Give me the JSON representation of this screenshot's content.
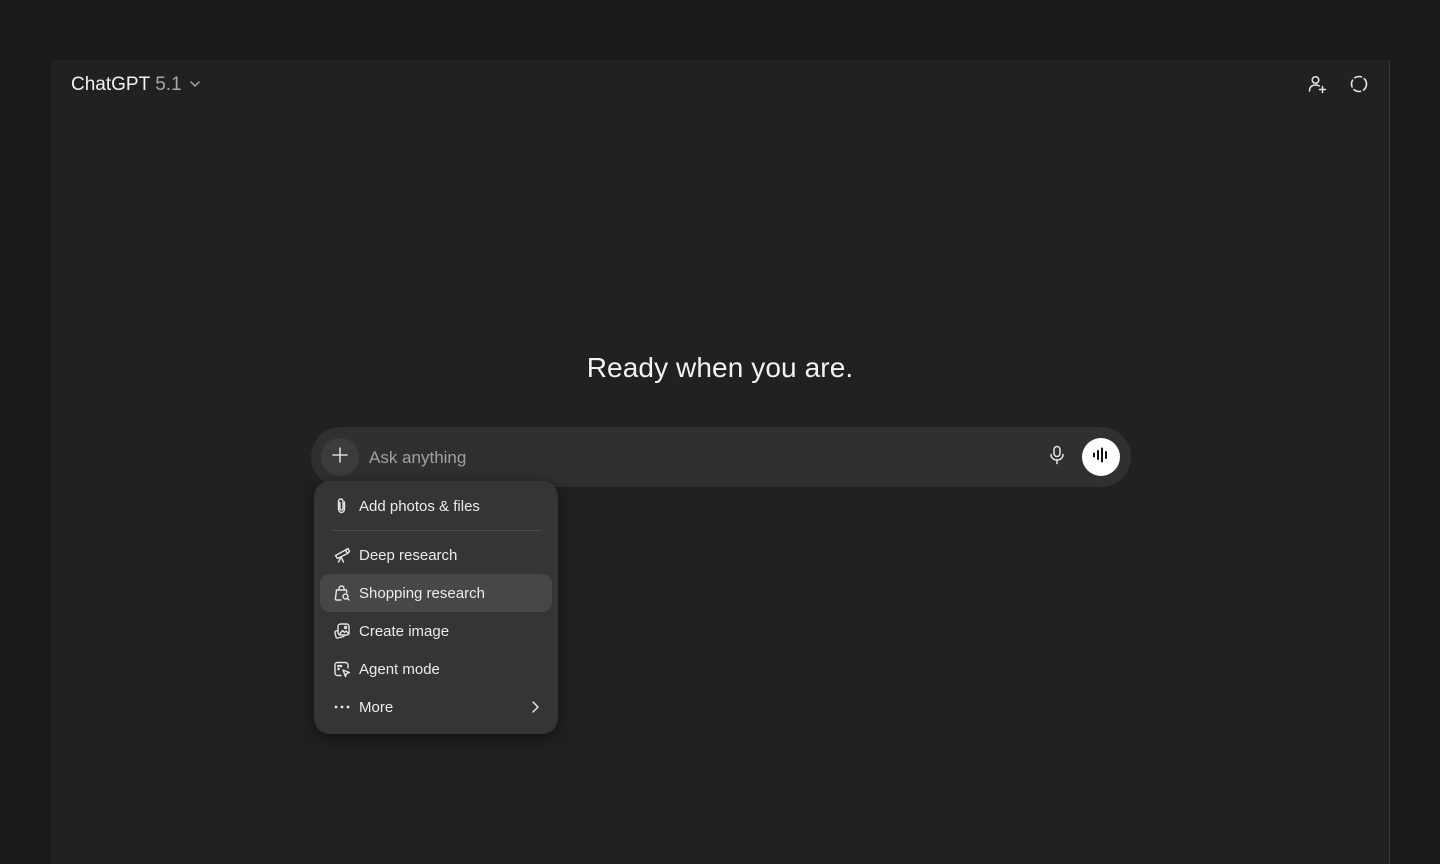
{
  "header": {
    "model_name": "ChatGPT",
    "model_version": "5.1",
    "model_switcher_icon": "chevron-down-icon",
    "actions": [
      {
        "name": "add-people-button",
        "icon": "person-add-icon"
      },
      {
        "name": "temporary-chat-button",
        "icon": "dashed-chat-icon"
      }
    ]
  },
  "main": {
    "hero_text": "Ready when you are."
  },
  "composer": {
    "placeholder": "Ask anything",
    "value": "",
    "plus_icon": "plus-icon",
    "mic_icon": "microphone-icon",
    "voice_icon": "voice-waveform-icon"
  },
  "menu": {
    "items": [
      {
        "label": "Add photos & files",
        "icon": "paperclip-icon"
      },
      {
        "label": "Deep research",
        "icon": "telescope-icon"
      },
      {
        "label": "Shopping research",
        "icon": "shopping-bag-search-icon",
        "active": true
      },
      {
        "label": "Create image",
        "icon": "image-create-icon"
      },
      {
        "label": "Agent mode",
        "icon": "agent-cursor-icon"
      },
      {
        "label": "More",
        "icon": "ellipsis-icon",
        "submenu_icon": "chevron-right-icon"
      }
    ]
  },
  "colors": {
    "page_background": "#1b1b1d",
    "window_background": "#212121",
    "composer_background": "#303030",
    "menu_background": "#353535",
    "menu_active": "#474747",
    "text_primary": "#ececec",
    "text_muted": "#a0a0a0"
  }
}
